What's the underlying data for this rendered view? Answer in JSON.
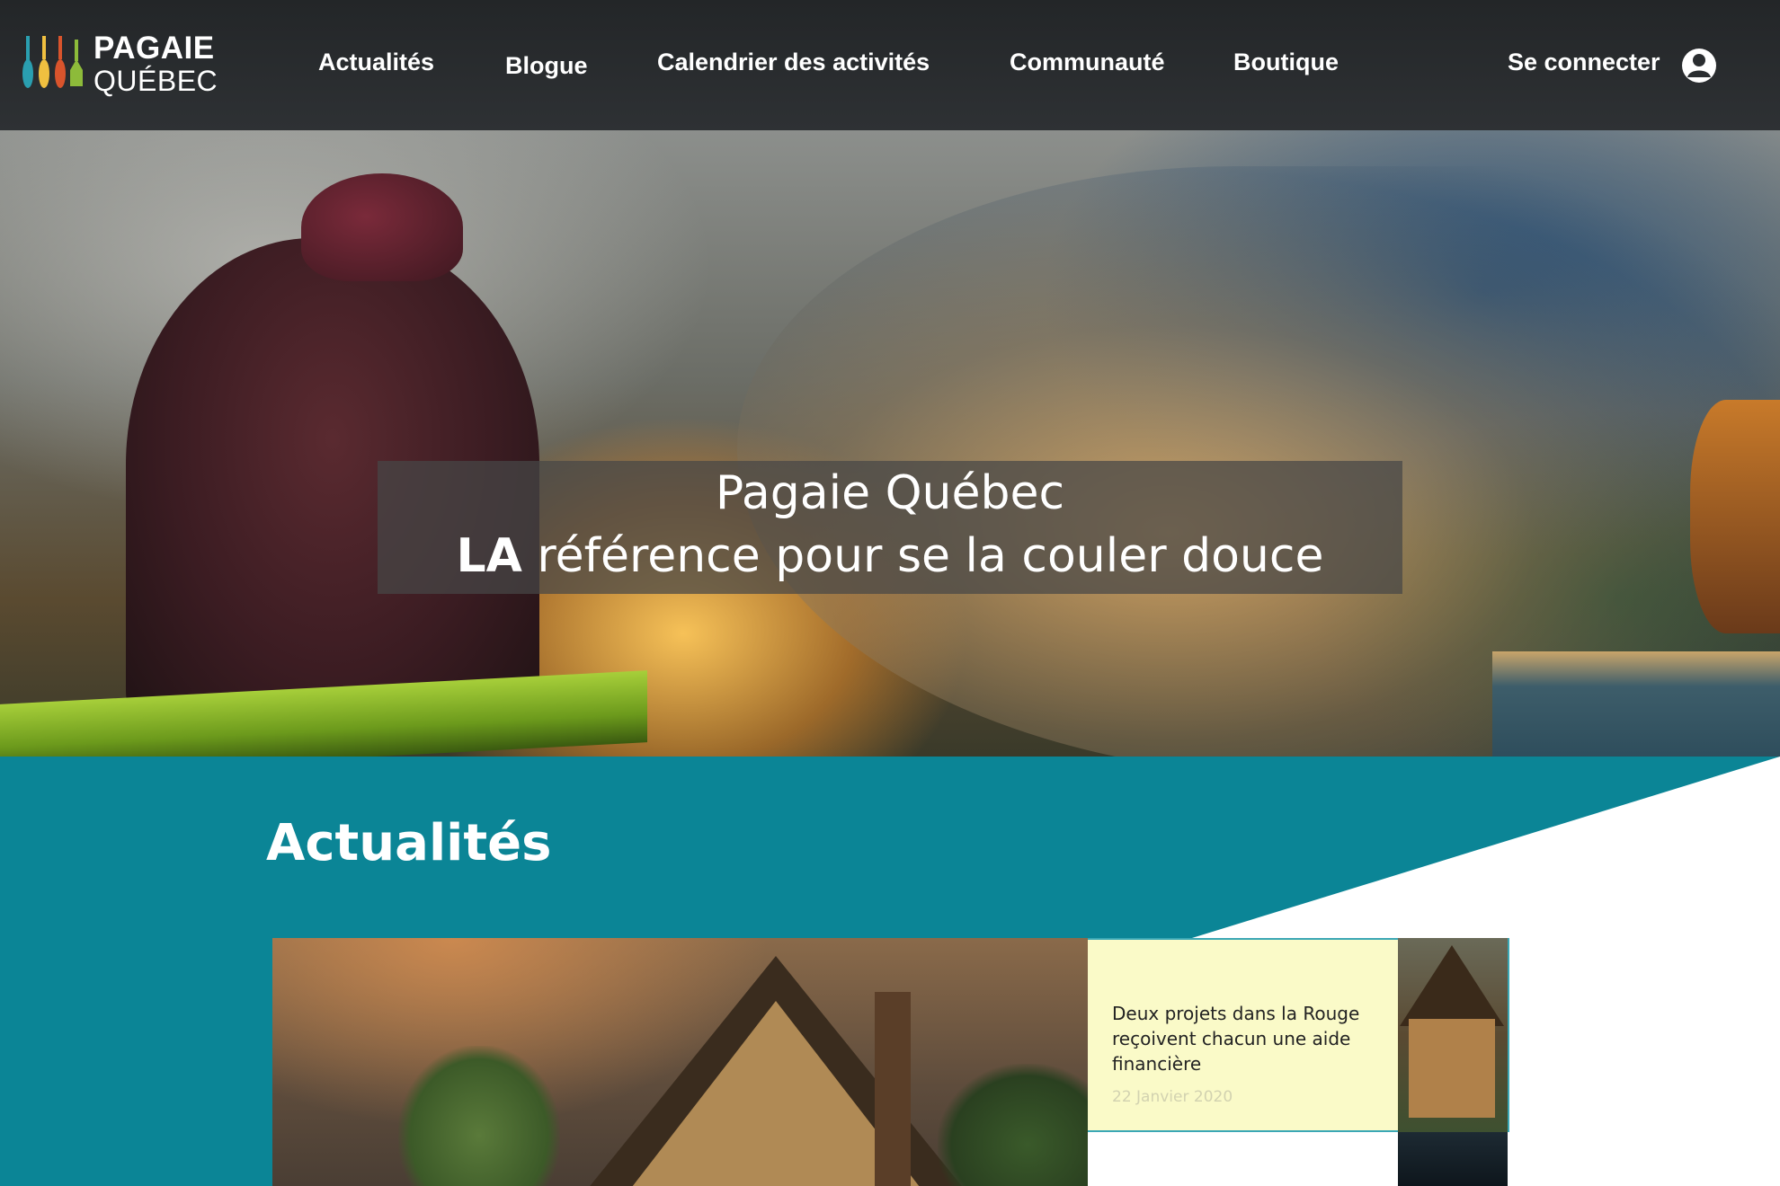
{
  "header": {
    "logo": {
      "line1": "PAGAIE",
      "line2": "QUÉBEC"
    },
    "nav": [
      {
        "label": "Actualités"
      },
      {
        "label": "Blogue"
      },
      {
        "label": "Calendrier des activités"
      },
      {
        "label": "Communauté"
      },
      {
        "label": "Boutique"
      }
    ],
    "login_label": "Se connecter",
    "login_icon": "user-icon"
  },
  "hero": {
    "title": "Pagaie Québec",
    "tagline_bold": "LA",
    "tagline_rest": " référence pour se la couler douce"
  },
  "news": {
    "heading": "Actualités",
    "cards": [
      {
        "title": "Deux projets dans la Rouge reçoivent chacun une aide financière",
        "date": "22 Janvier 2020"
      }
    ]
  },
  "colors": {
    "header_bg": "#2a2d30",
    "section_teal": "#0b8596",
    "card_bg": "#fafac8",
    "paddle_colors": [
      "#2a9fb0",
      "#f0c040",
      "#d9542c",
      "#8dbb3a"
    ]
  }
}
